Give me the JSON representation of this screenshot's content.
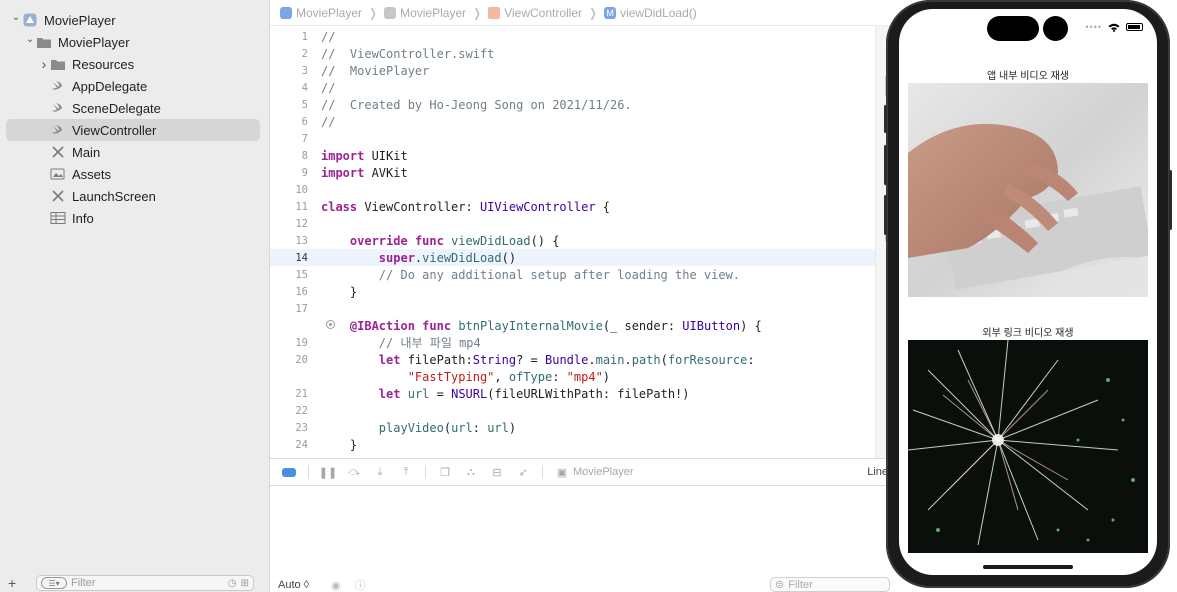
{
  "navigator": {
    "items": [
      {
        "label": "MoviePlayer",
        "icon": "project-icon",
        "chevron": "down",
        "indent": 0
      },
      {
        "label": "MoviePlayer",
        "icon": "folder-icon",
        "chevron": "down",
        "indent": 1
      },
      {
        "label": "Resources",
        "icon": "folder-icon",
        "chevron": "right",
        "indent": 2
      },
      {
        "label": "AppDelegate",
        "icon": "swift-file-icon",
        "chevron": "",
        "indent": 2
      },
      {
        "label": "SceneDelegate",
        "icon": "swift-file-icon",
        "chevron": "",
        "indent": 2
      },
      {
        "label": "ViewController",
        "icon": "swift-file-icon",
        "chevron": "",
        "indent": 2,
        "selected": true
      },
      {
        "label": "Main",
        "icon": "storyboard-icon",
        "chevron": "",
        "indent": 2
      },
      {
        "label": "Assets",
        "icon": "assets-icon",
        "chevron": "",
        "indent": 2
      },
      {
        "label": "LaunchScreen",
        "icon": "storyboard-icon",
        "chevron": "",
        "indent": 2
      },
      {
        "label": "Info",
        "icon": "plist-icon",
        "chevron": "",
        "indent": 2
      }
    ],
    "filter_placeholder": "Filter",
    "add_label": "+"
  },
  "jumpbar": {
    "crumbs": [
      "MoviePlayer",
      "MoviePlayer",
      "ViewController",
      "viewDidLoad()"
    ]
  },
  "editor": {
    "current_line": 14,
    "lines": [
      {
        "n": "1",
        "t": "//"
      },
      {
        "n": "2",
        "t": "//  ViewController.swift"
      },
      {
        "n": "3",
        "t": "//  MoviePlayer"
      },
      {
        "n": "4",
        "t": "//"
      },
      {
        "n": "5",
        "t": "//  Created by Ho-Jeong Song on 2021/11/26."
      },
      {
        "n": "6",
        "t": "//"
      },
      {
        "n": "7",
        "t": ""
      },
      {
        "n": "8",
        "t": "import UIKit"
      },
      {
        "n": "9",
        "t": "import AVKit"
      },
      {
        "n": "10",
        "t": ""
      },
      {
        "n": "11",
        "t": "class ViewController: UIViewController {"
      },
      {
        "n": "12",
        "t": ""
      },
      {
        "n": "13",
        "t": "    override func viewDidLoad() {"
      },
      {
        "n": "14",
        "t": "        super.viewDidLoad()"
      },
      {
        "n": "15",
        "t": "        // Do any additional setup after loading the view."
      },
      {
        "n": "16",
        "t": "    }"
      },
      {
        "n": "17",
        "t": ""
      },
      {
        "n": "",
        "t": "    @IBAction func btnPlayInternalMovie(_ sender: UIButton) {"
      },
      {
        "n": "19",
        "t": "        // 내부 파일 mp4"
      },
      {
        "n": "20",
        "t": "        let filePath:String? = Bundle.main.path(forResource:"
      },
      {
        "n": "",
        "t": "            \"FastTyping\", ofType: \"mp4\")"
      },
      {
        "n": "21",
        "t": "        let url = NSURL(fileURLWithPath: filePath!)"
      },
      {
        "n": "22",
        "t": ""
      },
      {
        "n": "23",
        "t": "        playVideo(url: url)"
      },
      {
        "n": "24",
        "t": "    }"
      }
    ]
  },
  "debugbar": {
    "scheme_label": "MoviePlayer",
    "line_indicator": "Line"
  },
  "console": {
    "output_selector": "Auto ◊",
    "filter_placeholder": "Filter"
  },
  "simulator": {
    "section1_label": "앱 내부 비디오 재생",
    "section2_label": "외부 링크 비디오 재생"
  },
  "colors": {
    "keyword": "#9b2393",
    "type": "#3900a0",
    "function": "#326d74",
    "comment": "#707f8c",
    "string": "#c41a16",
    "selection": "#d6d6d6",
    "accent": "#4a90e2"
  }
}
